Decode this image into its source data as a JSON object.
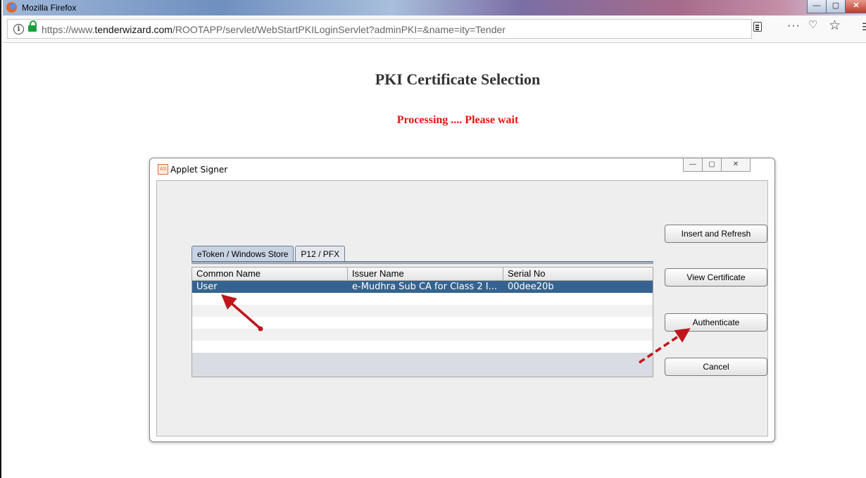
{
  "browser": {
    "window_title": "Mozilla Firefox",
    "url_prefix": "https://www.",
    "url_host": "tenderwizard.com",
    "url_path": "/ROOTAPP/servlet/WebStartPKILoginServlet?adminPKI=&name=ity=Tender",
    "window_buttons": {
      "minimize": "—",
      "maximize": "▢",
      "close": "✕"
    },
    "toolbar_more": "···",
    "icons": [
      "firefox-logo-icon",
      "info-icon",
      "lock-icon",
      "reader-view-icon",
      "more-icon",
      "pocket-icon",
      "bookmark-star-icon",
      "overflow-icon"
    ]
  },
  "page": {
    "title": "PKI Certificate Selection",
    "status": "Processing .... Please wait",
    "status_color": "#ee1111"
  },
  "dialog": {
    "title": "Applet Signer",
    "icon_text": "AS",
    "tabs": [
      {
        "label": "eToken / Windows Store",
        "active": true
      },
      {
        "label": "P12 / PFX",
        "active": false
      }
    ],
    "table": {
      "columns": [
        "Common Name",
        "Issuer Name",
        "Serial No"
      ],
      "rows": [
        {
          "common_name": "User",
          "issuer_name": "e-Mudhra Sub CA for Class 2 I...",
          "serial_no": "00dee20b",
          "selected": true
        }
      ]
    },
    "buttons": {
      "insert_refresh": "Insert and Refresh",
      "view_certificate": "View Certificate",
      "authenticate": "Authenticate",
      "cancel": "Cancel"
    },
    "selection_color": "#35638f",
    "annotation_color": "#c0151b"
  }
}
